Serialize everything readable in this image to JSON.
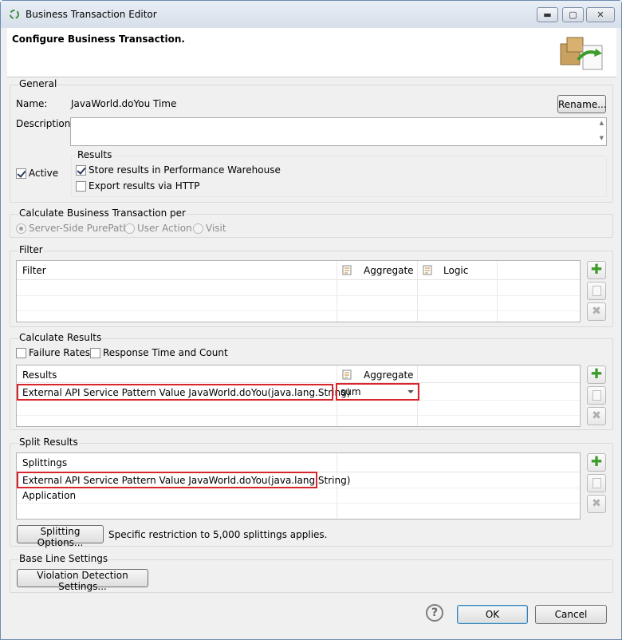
{
  "window": {
    "title": "Business Transaction Editor",
    "minimize": "▬",
    "maximize": "▢",
    "close": "✕"
  },
  "header": {
    "title": "Configure Business Transaction."
  },
  "general": {
    "title": "General",
    "name_label": "Name:",
    "name_value": "JavaWorld.doYou Time",
    "rename_button": "Rename...",
    "description_label": "Description:",
    "description_value": "",
    "active_label": "Active",
    "results_title": "Results",
    "store_results_label": "Store results in Performance Warehouse",
    "export_results_label": "Export results via HTTP"
  },
  "calculate_per": {
    "title": "Calculate Business Transaction per",
    "options": [
      "Server-Side PurePath",
      "User Action",
      "Visit"
    ]
  },
  "filter": {
    "title": "Filter",
    "columns": [
      "Filter",
      "Aggregate",
      "Logic"
    ]
  },
  "calculate_results": {
    "title": "Calculate Results",
    "failure_rates_label": "Failure Rates",
    "response_time_label": "Response Time and Count",
    "columns": [
      "Results",
      "Aggregate"
    ],
    "rows": [
      {
        "result": "External API Service Pattern Value JavaWorld.doYou(java.lang.String)",
        "aggregate": "sum"
      }
    ]
  },
  "split_results": {
    "title": "Split Results",
    "columns": [
      "Splittings"
    ],
    "rows": [
      "External API Service Pattern Value JavaWorld.doYou(java.lang.String)",
      "Application"
    ],
    "options_button": "Splitting Options...",
    "restriction_text": "Specific restriction to 5,000 splittings applies."
  },
  "baseline": {
    "title": "Base Line Settings",
    "violation_button": "Violation Detection Settings..."
  },
  "footer": {
    "help": "?",
    "ok": "OK",
    "cancel": "Cancel"
  },
  "colors": {
    "highlight": "#d9262b",
    "add_icon": "#3d9c2b"
  }
}
